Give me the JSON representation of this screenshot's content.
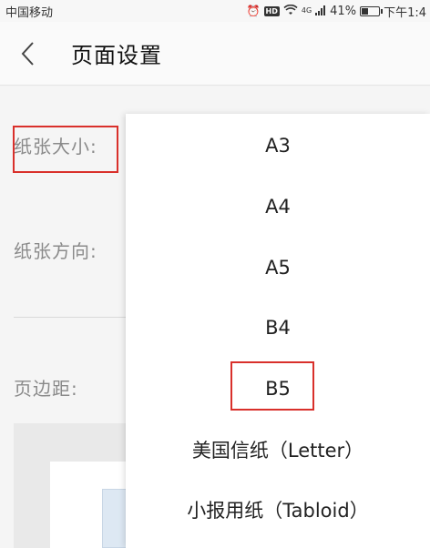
{
  "status_bar": {
    "carrier": "中国移动",
    "signal_label": "4G",
    "battery_percent": "41%",
    "battery_level": 0.41,
    "time": "下午1:4"
  },
  "header": {
    "title": "页面设置"
  },
  "settings": {
    "paper_size_label": "纸张大小:",
    "orientation_label": "纸张方向:",
    "margin_label": "页边距:"
  },
  "popup": {
    "options": [
      {
        "label": "A3"
      },
      {
        "label": "A4"
      },
      {
        "label": "A5"
      },
      {
        "label": "B4"
      },
      {
        "label": "B5"
      },
      {
        "label": "美国信纸（Letter）"
      },
      {
        "label": "小报用纸（Tabloid）"
      }
    ]
  },
  "colors": {
    "highlight": "#d9302b",
    "label_gray": "#8a8a8a"
  }
}
